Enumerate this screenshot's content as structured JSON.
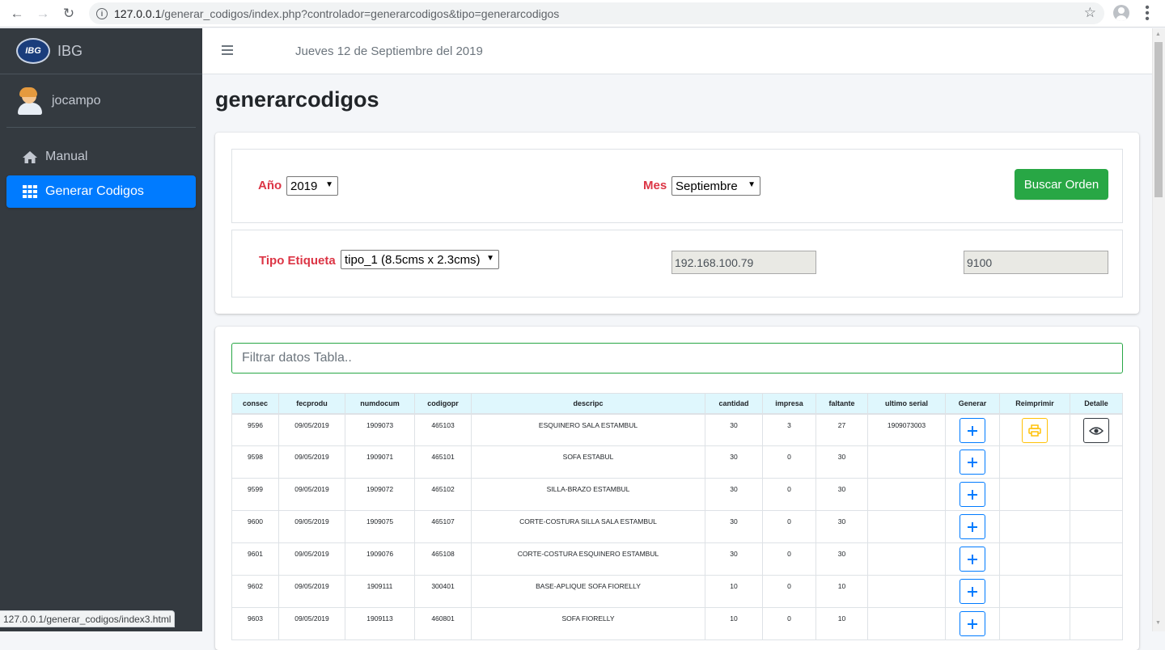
{
  "browser": {
    "url_host": "127.0.0.1",
    "url_path": "/generar_codigos/index.php?controlador=generarcodigos&tipo=generarcodigos",
    "status_url": "127.0.0.1/generar_codigos/index3.html"
  },
  "sidebar": {
    "brand_logo_text": "IBG",
    "brand_name": "IBG",
    "user_name": "jocampo",
    "items": [
      {
        "label": "Manual",
        "icon": "home-icon",
        "active": false
      },
      {
        "label": "Generar Codigos",
        "icon": "grid-icon",
        "active": true
      }
    ]
  },
  "topbar": {
    "date": "Jueves 12 de Septiembre del 2019"
  },
  "page": {
    "title": "generarcodigos"
  },
  "form": {
    "year_label": "Año",
    "year_value": "2019",
    "month_label": "Mes",
    "month_value": "Septiembre",
    "search_button": "Buscar Orden",
    "tipo_label": "Tipo Etiqueta",
    "tipo_value": "tipo_1 (8.5cms x 2.3cms)",
    "ip_value": "192.168.100.79",
    "port_value": "9100"
  },
  "filter": {
    "placeholder": "Filtrar datos Tabla.."
  },
  "table": {
    "headers": [
      "consec",
      "fecprodu",
      "numdocum",
      "codigopr",
      "descripc",
      "cantidad",
      "impresa",
      "faltante",
      "ultimo serial",
      "Generar",
      "Reimprimir",
      "Detalle"
    ],
    "rows": [
      {
        "consec": "9596",
        "fecprodu": "09/05/2019",
        "numdocum": "1909073",
        "codigopr": "465103",
        "descripc": "ESQUINERO SALA ESTAMBUL",
        "cantidad": "30",
        "impresa": "3",
        "faltante": "27",
        "ultimo_serial": "1909073003",
        "has_reprint": true
      },
      {
        "consec": "9598",
        "fecprodu": "09/05/2019",
        "numdocum": "1909071",
        "codigopr": "465101",
        "descripc": "SOFA ESTABUL",
        "cantidad": "30",
        "impresa": "0",
        "faltante": "30",
        "ultimo_serial": "",
        "has_reprint": false
      },
      {
        "consec": "9599",
        "fecprodu": "09/05/2019",
        "numdocum": "1909072",
        "codigopr": "465102",
        "descripc": "SILLA-BRAZO ESTAMBUL",
        "cantidad": "30",
        "impresa": "0",
        "faltante": "30",
        "ultimo_serial": "",
        "has_reprint": false
      },
      {
        "consec": "9600",
        "fecprodu": "09/05/2019",
        "numdocum": "1909075",
        "codigopr": "465107",
        "descripc": "CORTE-COSTURA SILLA SALA ESTAMBUL",
        "cantidad": "30",
        "impresa": "0",
        "faltante": "30",
        "ultimo_serial": "",
        "has_reprint": false
      },
      {
        "consec": "9601",
        "fecprodu": "09/05/2019",
        "numdocum": "1909076",
        "codigopr": "465108",
        "descripc": "CORTE-COSTURA ESQUINERO ESTAMBUL",
        "cantidad": "30",
        "impresa": "0",
        "faltante": "30",
        "ultimo_serial": "",
        "has_reprint": false
      },
      {
        "consec": "9602",
        "fecprodu": "09/05/2019",
        "numdocum": "1909111",
        "codigopr": "300401",
        "descripc": "BASE-APLIQUE SOFA FIORELLY",
        "cantidad": "10",
        "impresa": "0",
        "faltante": "10",
        "ultimo_serial": "",
        "has_reprint": false
      },
      {
        "consec": "9603",
        "fecprodu": "09/05/2019",
        "numdocum": "1909113",
        "codigopr": "460801",
        "descripc": "SOFA FIORELLY",
        "cantidad": "10",
        "impresa": "0",
        "faltante": "10",
        "ultimo_serial": "",
        "has_reprint": false
      }
    ]
  },
  "colors": {
    "sidebar_bg": "#343a40",
    "active_blue": "#007bff",
    "label_red": "#dc3545",
    "button_green": "#28a745",
    "reprint_yellow": "#ffc107",
    "table_header_bg": "#dff7fd"
  }
}
